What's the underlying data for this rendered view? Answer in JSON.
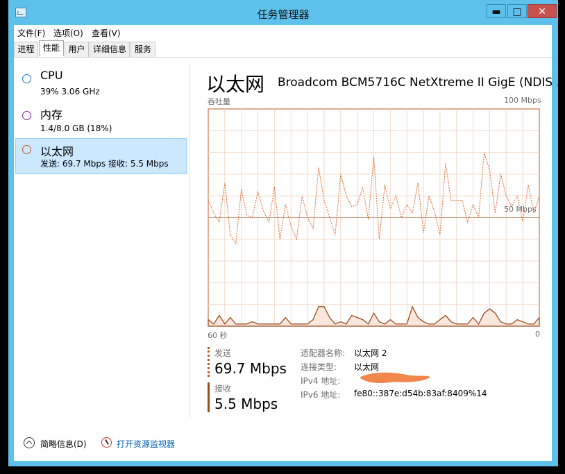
{
  "window": {
    "title": "任务管理器",
    "minimize": "▬",
    "maximize": "□",
    "close": "✕"
  },
  "menu": [
    "文件(F)",
    "选项(O)",
    "查看(V)"
  ],
  "tabs": [
    "进程",
    "性能",
    "用户",
    "详细信息",
    "服务"
  ],
  "active_tab": "性能",
  "left_list": [
    {
      "title": "CPU",
      "sub": "39% 3.06 GHz",
      "color": "#1f7ad6"
    },
    {
      "title": "内存",
      "sub": "1.4/8.0 GB (18%)",
      "color": "#8b1f9e"
    },
    {
      "title": "以太网",
      "sub": "发送: 69.7 Mbps  接收: 5.5 Mbps",
      "color": "#c35a1f"
    }
  ],
  "header": {
    "title": "以太网",
    "adapter": "Broadcom BCM5716C NetXtreme II GigE (NDIS ..."
  },
  "chart_labels": {
    "throughput": "吞吐量",
    "max": "100 Mbps",
    "mid": "50 Mbps",
    "time_start": "60 秒",
    "time_end": "0"
  },
  "chart_data": {
    "type": "line",
    "x": [
      60,
      59,
      58,
      57,
      56,
      55,
      54,
      53,
      52,
      51,
      50,
      49,
      48,
      47,
      46,
      45,
      44,
      43,
      42,
      41,
      40,
      39,
      38,
      37,
      36,
      35,
      34,
      33,
      32,
      31,
      30,
      29,
      28,
      27,
      26,
      25,
      24,
      23,
      22,
      21,
      20,
      19,
      18,
      17,
      16,
      15,
      14,
      13,
      12,
      11,
      10,
      9,
      8,
      7,
      6,
      5,
      4,
      3,
      2,
      1,
      0
    ],
    "series": [
      {
        "values": [
          58,
          52,
          48,
          66,
          42,
          38,
          63,
          51,
          50,
          62,
          53,
          48,
          64,
          40,
          56,
          46,
          40,
          60,
          50,
          45,
          73,
          58,
          50,
          42,
          70,
          60,
          55,
          56,
          64,
          49,
          78,
          40,
          65,
          54,
          60,
          50,
          56,
          52,
          66,
          43,
          60,
          53,
          42,
          75,
          58,
          58,
          58,
          48,
          56,
          50,
          80,
          72,
          52,
          70,
          60,
          55,
          60,
          48,
          65,
          52,
          60
        ]
      },
      {
        "values": [
          3,
          1,
          5,
          1,
          4,
          1,
          1,
          1,
          2,
          1,
          1,
          1,
          1,
          1,
          4,
          1,
          1,
          1,
          1,
          3,
          9,
          9,
          4,
          1,
          2,
          1,
          5,
          4,
          3,
          1,
          6,
          2,
          1,
          3,
          1,
          1,
          1,
          9,
          4,
          2,
          1,
          1,
          3,
          5,
          2,
          1,
          1,
          1,
          4,
          1,
          6,
          8,
          6,
          2,
          1,
          1,
          3,
          2,
          1,
          1,
          4
        ]
      }
    ],
    "ylim": [
      0,
      100
    ],
    "xlim": [
      60,
      0
    ],
    "grid": true,
    "colors": [
      "#c35a1f",
      "#9c4a1a"
    ]
  },
  "stats": {
    "send_label": "发送",
    "send_value": "69.7 Mbps",
    "recv_label": "接收",
    "recv_value": "5.5 Mbps"
  },
  "details": [
    {
      "key": "适配器名称:",
      "value": "以太网 2"
    },
    {
      "key": "连接类型:",
      "value": "以太网"
    },
    {
      "key": "IPv4 地址:",
      "value": ""
    },
    {
      "key": "IPv6 地址:",
      "value": "fe80::387e:d54b:83af:8409%14"
    }
  ],
  "footer": {
    "fewer_details": "简略信息(D)",
    "resource_monitor": "打开资源监视器"
  }
}
